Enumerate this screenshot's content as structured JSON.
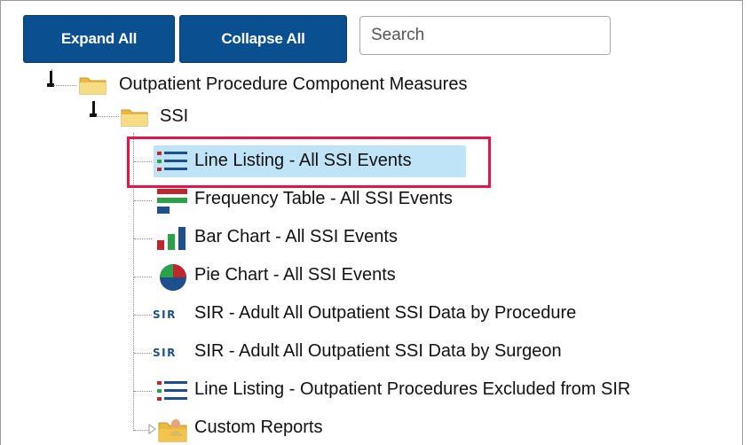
{
  "toolbar": {
    "expand_all_label": "Expand All",
    "collapse_all_label": "Collapse All",
    "search_placeholder": "Search",
    "search_value": ""
  },
  "tree": {
    "root": {
      "label": "Outpatient Procedure Component Measures",
      "icon": "folder-open-icon"
    },
    "group": {
      "label": "SSI",
      "icon": "folder-open-icon"
    },
    "items": [
      {
        "label": "Line Listing - All SSI Events",
        "icon": "line-listing-icon",
        "selected": true
      },
      {
        "label": "Frequency Table - All SSI Events",
        "icon": "frequency-table-icon"
      },
      {
        "label": "Bar Chart - All SSI Events",
        "icon": "bar-chart-icon"
      },
      {
        "label": "Pie Chart - All SSI Events",
        "icon": "pie-chart-icon"
      },
      {
        "label": "SIR - Adult All Outpatient SSI Data by Procedure",
        "icon": "sir-icon",
        "icon_text": "SIR"
      },
      {
        "label": "SIR - Adult All Outpatient SSI Data by Surgeon",
        "icon": "sir-icon",
        "icon_text": "SIR"
      },
      {
        "label": "Line Listing - Outpatient Procedures Excluded from SIR",
        "icon": "line-listing-icon"
      },
      {
        "label": "Custom Reports",
        "icon": "custom-reports-folder-icon"
      }
    ]
  },
  "colors": {
    "button_bg": "#0a4f8f",
    "selection_bg": "#bfe3f7",
    "highlight_border": "#e0184a"
  }
}
